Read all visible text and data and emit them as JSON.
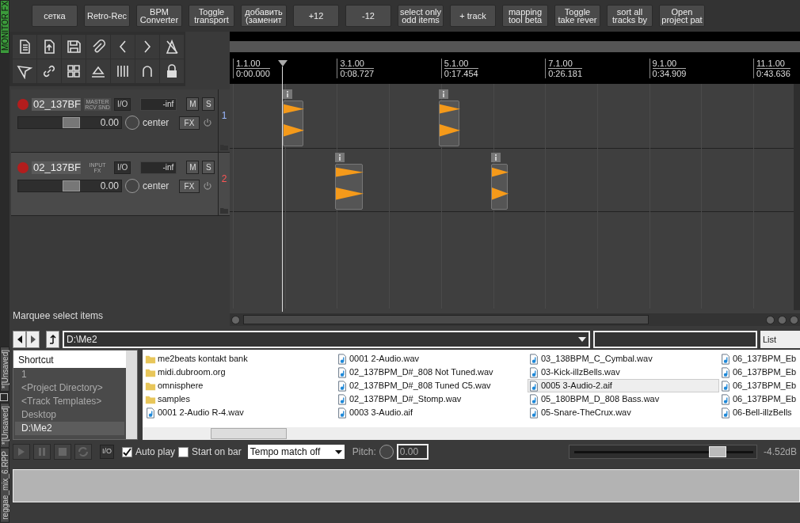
{
  "side_tabs": {
    "monitor": "MONITOR FX",
    "projects": [
      {
        "label": "*[Unsaved]",
        "closable": true
      },
      {
        "label": "*[Unsaved]",
        "closable": false
      },
      {
        "label": "reggae_mix_6.RPP",
        "closable": false
      }
    ]
  },
  "toolbar_buttons": [
    [
      "сетка"
    ],
    [
      "Retro-Rec"
    ],
    [
      "BPM",
      "Converter"
    ],
    [
      "Toggle",
      "transport"
    ],
    [
      "добавить",
      "(заменит"
    ],
    [
      "+12"
    ],
    [
      "-12"
    ],
    [
      "select only",
      "odd items"
    ],
    [
      "+ track"
    ],
    [
      "mapping",
      "tool beta"
    ],
    [
      "Toggle",
      "take rever"
    ],
    [
      "sort all",
      "tracks by"
    ],
    [
      "Open",
      "project pat"
    ]
  ],
  "ruler": [
    {
      "bar": "1.1.00",
      "time": "0:00.000"
    },
    {
      "bar": "3.1.00",
      "time": "0:08.727"
    },
    {
      "bar": "5.1.00",
      "time": "0:17.454"
    },
    {
      "bar": "7.1.00",
      "time": "0:26.181"
    },
    {
      "bar": "9.1.00",
      "time": "0:34.909"
    },
    {
      "bar": "11.1.00",
      "time": "0:43.636"
    }
  ],
  "tracks": [
    {
      "name": "02_137BF",
      "route_label": [
        "MASTER",
        "RCV SND"
      ],
      "io": "I/O",
      "meter": "-inf",
      "mute": "M",
      "solo": "S",
      "volume": "0.00",
      "pan": "center",
      "fx": "FX",
      "number": "1",
      "selected": false
    },
    {
      "name": "02_137BF",
      "route_label": [
        "INPUT",
        "FX"
      ],
      "io": "I/O",
      "meter": "-inf",
      "mute": "M",
      "solo": "S",
      "volume": "0.00",
      "pan": "center",
      "fx": "FX",
      "number": "2",
      "selected": true
    }
  ],
  "status": "Marquee select items",
  "explorer": {
    "path": "D:\\Me2",
    "view": "List",
    "shortcut_header": "Shortcut",
    "shortcuts": [
      {
        "label": "1",
        "selected": false
      },
      {
        "label": "<Project Directory>",
        "selected": false
      },
      {
        "label": "<Track Templates>",
        "selected": false
      },
      {
        "label": "Desktop",
        "selected": false
      },
      {
        "label": "D:\\Me2",
        "selected": true
      }
    ],
    "files": [
      {
        "name": "me2beats kontakt bank",
        "kind": "folder",
        "selected": false
      },
      {
        "name": "midi.dubroom.org",
        "kind": "folder",
        "selected": false
      },
      {
        "name": "omnisphere",
        "kind": "folder",
        "selected": false
      },
      {
        "name": "samples",
        "kind": "folder",
        "selected": false
      },
      {
        "name": "0001 2-Audio R-4.wav",
        "kind": "audio",
        "selected": false
      },
      {
        "name": "0001 2-Audio.wav",
        "kind": "audio",
        "selected": false
      },
      {
        "name": "02_137BPM_D#_808 Not Tuned.wav",
        "kind": "audio",
        "selected": false
      },
      {
        "name": "02_137BPM_D#_808 Tuned C5.wav",
        "kind": "audio",
        "selected": false
      },
      {
        "name": "02_137BPM_D#_Stomp.wav",
        "kind": "audio",
        "selected": false
      },
      {
        "name": "0003 3-Audio.aif",
        "kind": "audio",
        "selected": false
      },
      {
        "name": "03_138BPM_C_Cymbal.wav",
        "kind": "audio",
        "selected": false
      },
      {
        "name": "03-Kick-illzBells.wav",
        "kind": "audio",
        "selected": false
      },
      {
        "name": "0005 3-Audio-2.aif",
        "kind": "audio",
        "selected": true
      },
      {
        "name": "05_180BPM_D_808 Bass.wav",
        "kind": "audio",
        "selected": false
      },
      {
        "name": "05-Snare-TheCrux.wav",
        "kind": "audio",
        "selected": false
      },
      {
        "name": "06_137BPM_Eb",
        "kind": "audio",
        "selected": false
      },
      {
        "name": "06_137BPM_Eb",
        "kind": "audio",
        "selected": false
      },
      {
        "name": "06_137BPM_Eb",
        "kind": "audio",
        "selected": false
      },
      {
        "name": "06_137BPM_Eb",
        "kind": "audio",
        "selected": false
      },
      {
        "name": "06-Bell-illzBells",
        "kind": "audio",
        "selected": false
      }
    ],
    "io": "I/O",
    "auto_play": {
      "label": "Auto play",
      "checked": true
    },
    "start_on_bar": {
      "label": "Start on bar",
      "checked": false
    },
    "tempo": "Tempo match off",
    "pitch_label": "Pitch:",
    "pitch": "0.00",
    "volume": {
      "level": 0.8
    },
    "volume_reading": "-4.52dB"
  }
}
